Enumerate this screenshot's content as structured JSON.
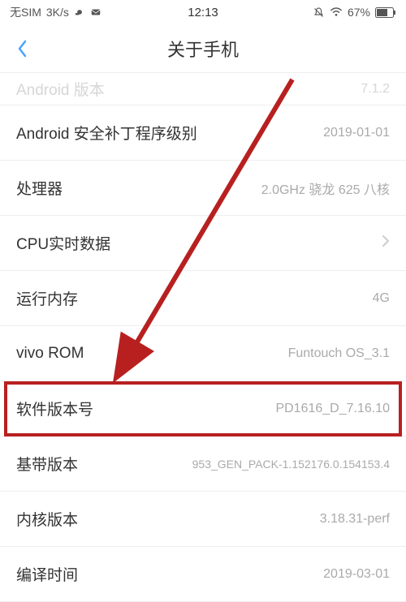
{
  "status": {
    "sim": "无SIM",
    "speed": "3K/s",
    "time": "12:13",
    "battery_pct": "67%"
  },
  "header": {
    "title": "关于手机"
  },
  "rows": [
    {
      "label": "Android 版本",
      "value": "7.1.2"
    },
    {
      "label": "Android 安全补丁程序级别",
      "value": "2019-01-01"
    },
    {
      "label": "处理器",
      "value": "2.0GHz 骁龙 625 八核"
    },
    {
      "label": "CPU实时数据",
      "value": ""
    },
    {
      "label": "运行内存",
      "value": "4G"
    },
    {
      "label": "vivo ROM",
      "value": "Funtouch OS_3.1"
    },
    {
      "label": "软件版本号",
      "value": "PD1616_D_7.16.10"
    },
    {
      "label": "基带版本",
      "value": "953_GEN_PACK-1.152176.0.154153.4"
    },
    {
      "label": "内核版本",
      "value": "3.18.31-perf"
    },
    {
      "label": "编译时间",
      "value": "2019-03-01"
    }
  ],
  "annotation": {
    "color": "#b82020"
  }
}
